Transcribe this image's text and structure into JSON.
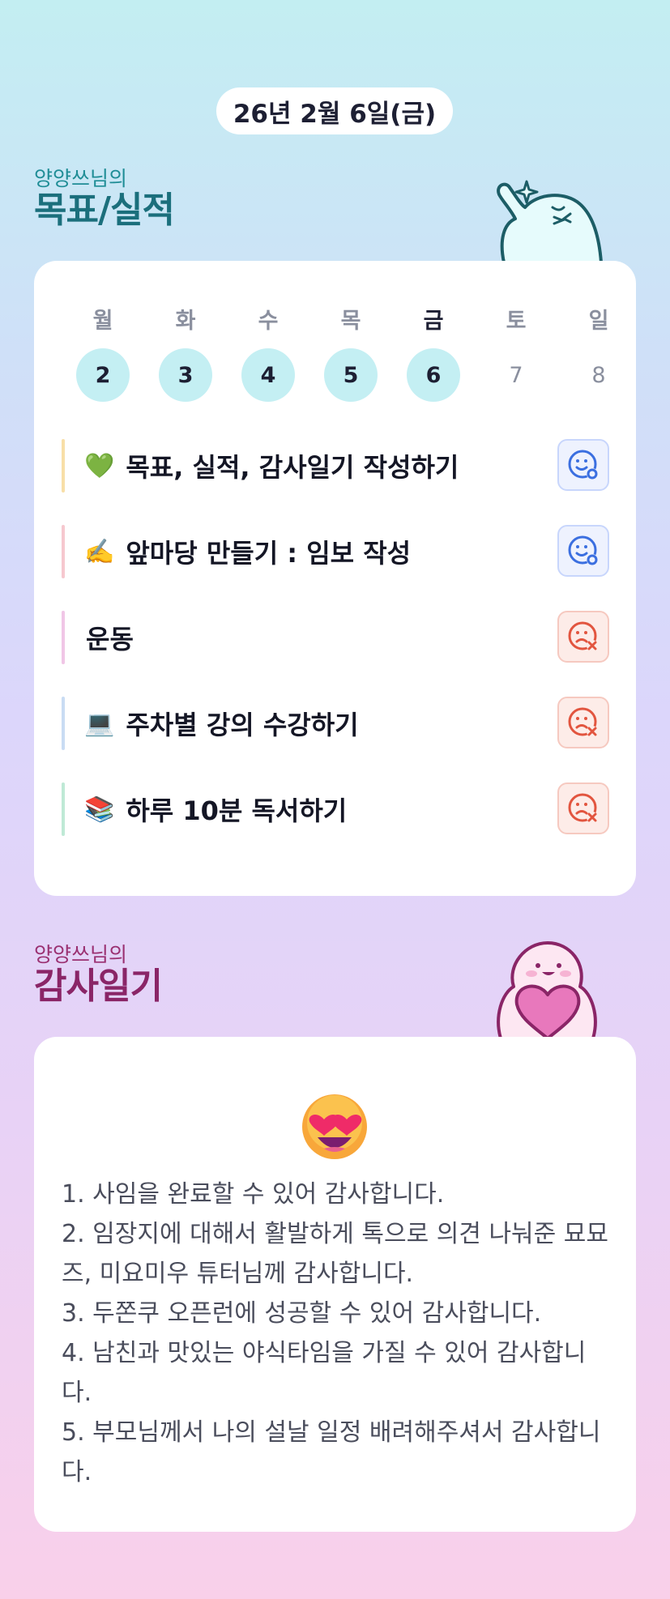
{
  "date": "26년 2월 6일(금)",
  "goals_section": {
    "owner": "양양쓰님의",
    "title": "목표/실적"
  },
  "week": {
    "days": [
      "월",
      "화",
      "수",
      "목",
      "금",
      "토",
      "일"
    ],
    "dates": [
      "2",
      "3",
      "4",
      "5",
      "6",
      "7",
      "8"
    ],
    "today_index": 4
  },
  "goals": [
    {
      "emoji": "💚",
      "text": "목표, 실적, 감사일기 작성하기",
      "status": "success",
      "bar_color": "#f8dfa8"
    },
    {
      "emoji": "✍️",
      "text": "앞마당 만들기 : 임보 작성",
      "status": "success",
      "bar_color": "#f6c8cf"
    },
    {
      "emoji": "",
      "text": "운동",
      "status": "fail",
      "bar_color": "#f0c6e6"
    },
    {
      "emoji": "💻",
      "text": "주차별 강의 수강하기",
      "status": "fail",
      "bar_color": "#c9dcf3"
    },
    {
      "emoji": "📚",
      "text": "하루 10분 독서하기",
      "status": "fail",
      "bar_color": "#bfe9d6"
    }
  ],
  "gratitude_section": {
    "owner": "양양쓰님의",
    "title": "감사일기"
  },
  "gratitude": {
    "mood_icon": "heart-eyes-emoji-icon",
    "lines": [
      "1. 사임을 완료할 수 있어 감사합니다.",
      "2. 임장지에 대해서 활발하게 톡으로 의견 나눠준 묘묘즈, 미요미우 튜터님께 감사합니다.",
      "3. 두쫀쿠 오픈런에 성공할 수 있어 감사합니다.",
      "4. 남친과 맛있는 야식타임을 가질 수 있어 감사합니다.",
      "5. 부모님께서 나의 설날 일정 배려해주셔서 감사합니다."
    ]
  },
  "colors": {
    "success": "#3b6fe0",
    "fail": "#e2553f"
  }
}
